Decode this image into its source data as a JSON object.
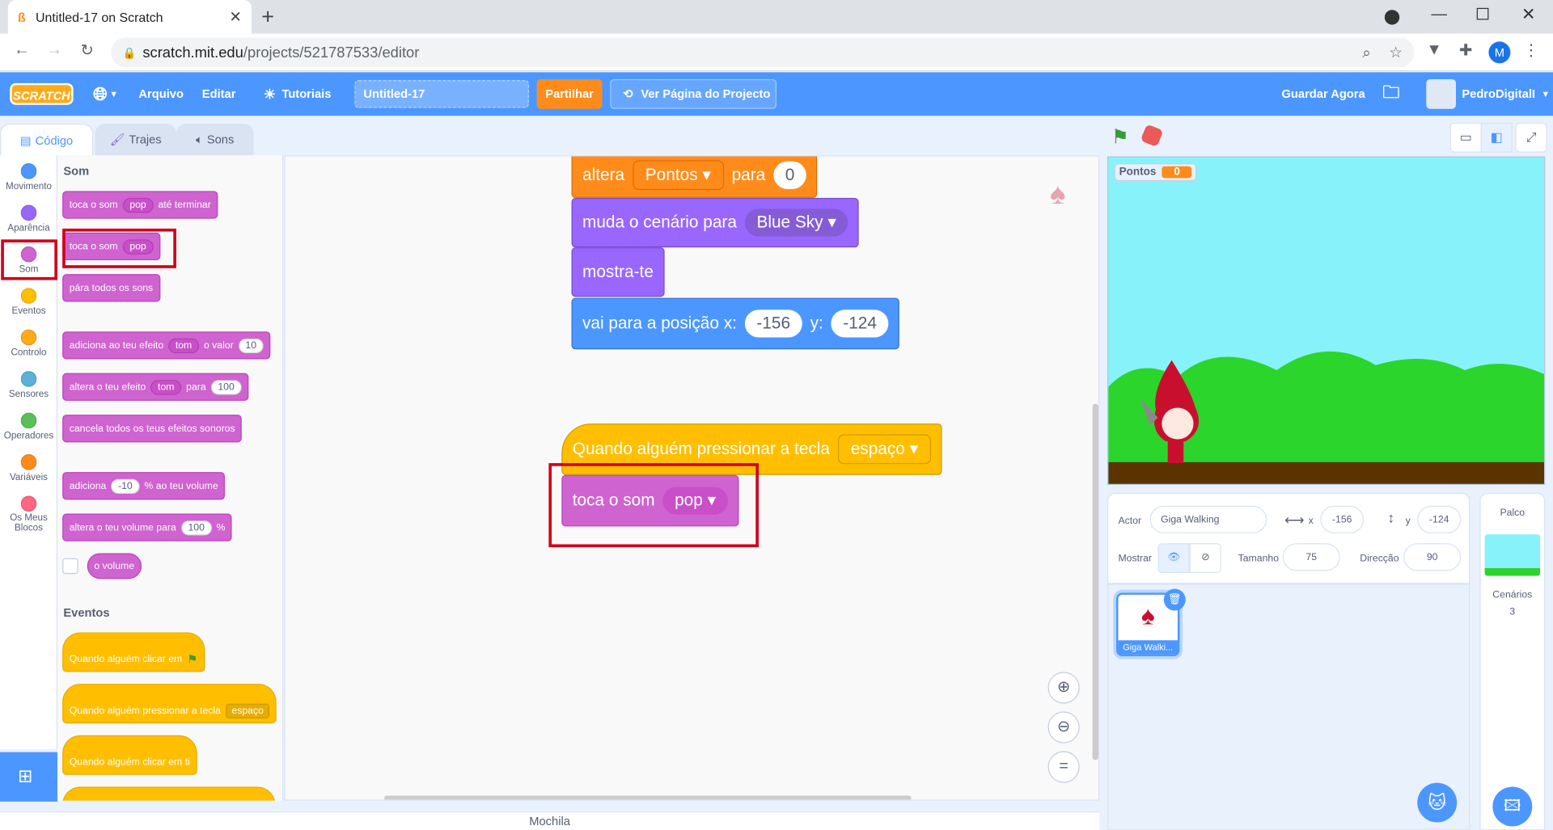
{
  "browser": {
    "tab_title": "Untitled-17 on Scratch",
    "new_tab": "+",
    "url_host": "scratch.mit.edu",
    "url_path": "/projects/521787533/editor",
    "profile_letter": "M"
  },
  "menubar": {
    "logo": "SCRATCH",
    "file": "Arquivo",
    "edit": "Editar",
    "tutorials": "Tutoriais",
    "project_title": "Untitled-17",
    "share": "Partilhar",
    "see_page": "Ver Página do Projecto",
    "save_now": "Guardar Agora",
    "username": "PedroDigitalI"
  },
  "editor_tabs": {
    "code": "Código",
    "costumes": "Trajes",
    "sounds": "Sons"
  },
  "categories": [
    {
      "label": "Movimento",
      "color": "#4c97ff"
    },
    {
      "label": "Aparência",
      "color": "#9966ff"
    },
    {
      "label": "Som",
      "color": "#cf63cf"
    },
    {
      "label": "Eventos",
      "color": "#ffbf00"
    },
    {
      "label": "Controlo",
      "color": "#ffab19"
    },
    {
      "label": "Sensores",
      "color": "#5cb1d6"
    },
    {
      "label": "Operadores",
      "color": "#59c059"
    },
    {
      "label": "Variáveis",
      "color": "#ff8c1a"
    },
    {
      "label": "Os Meus Blocos",
      "color": "#ff6680"
    }
  ],
  "palette": {
    "sound_heading": "Som",
    "play_until": {
      "a": "toca o som",
      "dd": "pop",
      "b": "até terminar"
    },
    "start_sound": {
      "a": "toca o som",
      "dd": "pop"
    },
    "stop_all": "pára todos os sons",
    "change_effect": {
      "a": "adiciona ao teu efeito",
      "dd": "tom",
      "b": "o valor",
      "n": "10"
    },
    "set_effect": {
      "a": "altera o teu efeito",
      "dd": "tom",
      "b": "para",
      "n": "100"
    },
    "clear_effects": "cancela todos os teus efeitos sonoros",
    "change_volume": {
      "a": "adiciona",
      "n": "-10",
      "b": "% ao teu volume"
    },
    "set_volume": {
      "a": "altera o teu volume para",
      "n": "100",
      "b": "%"
    },
    "volume_reporter": "o volume",
    "events_heading": "Eventos",
    "when_flag": "Quando alguém clicar em",
    "when_key": {
      "a": "Quando alguém pressionar a tecla",
      "dd": "espaço"
    },
    "when_sprite": "Quando alguém clicar em ti"
  },
  "script": {
    "set_var": {
      "a": "altera",
      "dd": "Pontos",
      "b": "para",
      "n": "0"
    },
    "switch_backdrop": {
      "a": "muda o cenário para",
      "dd": "Blue Sky"
    },
    "show": "mostra-te",
    "goto": {
      "a": "vai para a posição x:",
      "x": "-156",
      "b": "y:",
      "y": "-124"
    },
    "when_key": {
      "a": "Quando alguém pressionar a tecla",
      "dd": "espaço"
    },
    "start_sound": {
      "a": "toca o som",
      "dd": "pop"
    }
  },
  "stage": {
    "monitor_label": "Pontos",
    "monitor_value": "0"
  },
  "sprite_info": {
    "actor_label": "Actor",
    "actor_name": "Giga Walking",
    "x_label": "x",
    "x": "-156",
    "y_label": "y",
    "y": "-124",
    "show_label": "Mostrar",
    "size_label": "Tamanho",
    "size": "75",
    "direction_label": "Direcção",
    "direction": "90"
  },
  "sprite_list": [
    {
      "name": "Giga Walki..."
    }
  ],
  "stage_panel": {
    "title": "Palco",
    "backdrops_label": "Cenários",
    "backdrops_count": "3"
  },
  "backpack": "Mochila"
}
